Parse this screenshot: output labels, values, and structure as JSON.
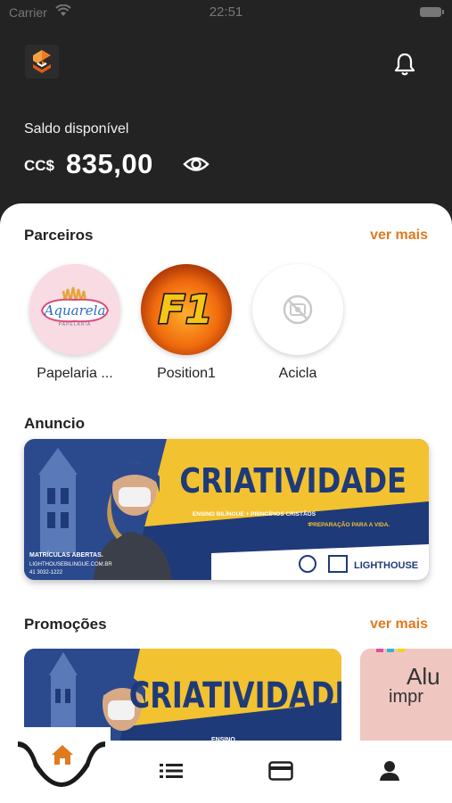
{
  "status_bar": {
    "carrier": "Carrier",
    "time": "22:51"
  },
  "header": {
    "balance_label": "Saldo disponível",
    "currency": "CC$",
    "amount": "835,00"
  },
  "partners": {
    "title": "Parceiros",
    "see_more": "ver mais",
    "items": [
      {
        "name": "Papelaria ...",
        "logo_text": "Aquarela",
        "logo_subtext": "PAPELARIA"
      },
      {
        "name": "Position1",
        "logo_text": "F1"
      },
      {
        "name": "Acicla"
      }
    ]
  },
  "ad": {
    "title": "Anuncio",
    "banner": {
      "headline": "CRIATIVIDADE",
      "subtext_left": "ENSINO BILÍNGUE + PRINCÍPIOS CRISTÃOS",
      "subtext_right": "PREPARAÇÃO PARA A VIDA.",
      "enroll": "MATRÍCULAS ABERTAS.",
      "site": "LIGHTHOUSEBILINGUE.COM.BR",
      "phone": "41 3032-1222",
      "brand": "LIGHTHOUSE"
    }
  },
  "promotions": {
    "title": "Promoções",
    "see_more": "ver mais",
    "card1_headline": "CRIATIVIDADE",
    "card1_small": "ENSINO",
    "card2_text_1": "Alu",
    "card2_text_2": "impr"
  },
  "colors": {
    "accent": "#e07a1f",
    "header_bg": "#232323",
    "banner_blue": "#1f3a78",
    "banner_yellow": "#f2c230"
  }
}
